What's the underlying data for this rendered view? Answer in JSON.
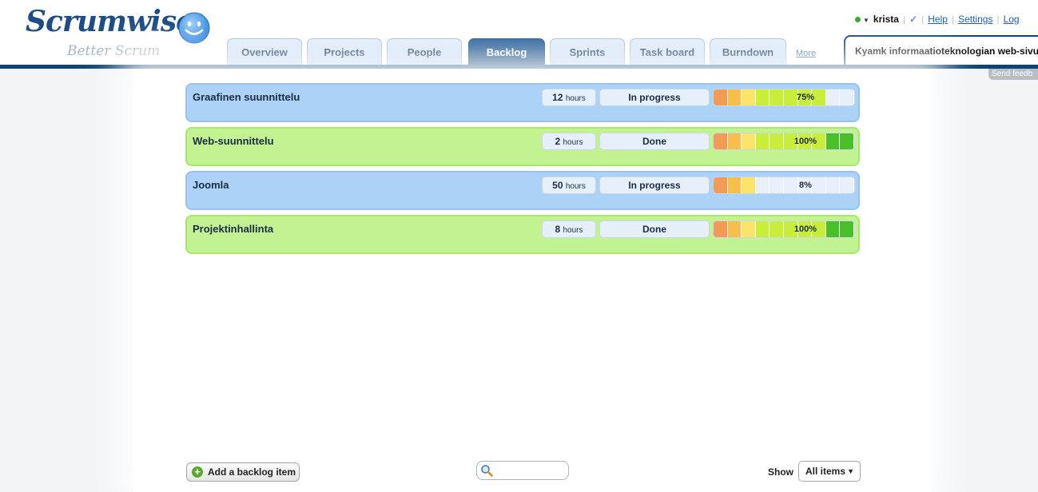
{
  "brand": {
    "name": "Scrumwise",
    "tagline": "Better Scrum"
  },
  "nav": {
    "tabs": [
      {
        "label": "Overview",
        "active": false
      },
      {
        "label": "Projects",
        "active": false
      },
      {
        "label": "People",
        "active": false
      },
      {
        "label": "Backlog",
        "active": true
      },
      {
        "label": "Sprints",
        "active": false
      },
      {
        "label": "Task board",
        "active": false
      },
      {
        "label": "Burndown",
        "active": false
      }
    ],
    "more_label": "More"
  },
  "project_selector": {
    "value": "Kyamk informaatioteknologian web-sivut"
  },
  "user_bar": {
    "username": "krista",
    "status_color": "#37a834",
    "help_label": "Help",
    "settings_label": "Settings",
    "logout_label": "Log"
  },
  "feedback_label": "Send feedb",
  "backlog": {
    "items": [
      {
        "title": "Graafinen suunnittelu",
        "hours": "12",
        "hours_unit": "hours",
        "status": "In progress",
        "progress_percent": 75,
        "progress_label": "75%",
        "color": "blue"
      },
      {
        "title": "Web-suunnittelu",
        "hours": "2",
        "hours_unit": "hours",
        "status": "Done",
        "progress_percent": 100,
        "progress_label": "100%",
        "color": "green"
      },
      {
        "title": "Joomla",
        "hours": "50",
        "hours_unit": "hours",
        "status": "In progress",
        "progress_percent": 8,
        "progress_label": "8%",
        "color": "blue"
      },
      {
        "title": "Projektinhallinta",
        "hours": "8",
        "hours_unit": "hours",
        "status": "Done",
        "progress_percent": 100,
        "progress_label": "100%",
        "color": "green"
      }
    ]
  },
  "footer": {
    "add_button_label": "Add a backlog item",
    "search_placeholder": "",
    "show_label": "Show",
    "filter_value": "All items"
  },
  "colors": {
    "nav_dark": "#0f4378",
    "item_blue": "#acd2f7",
    "item_green": "#c2f291"
  }
}
